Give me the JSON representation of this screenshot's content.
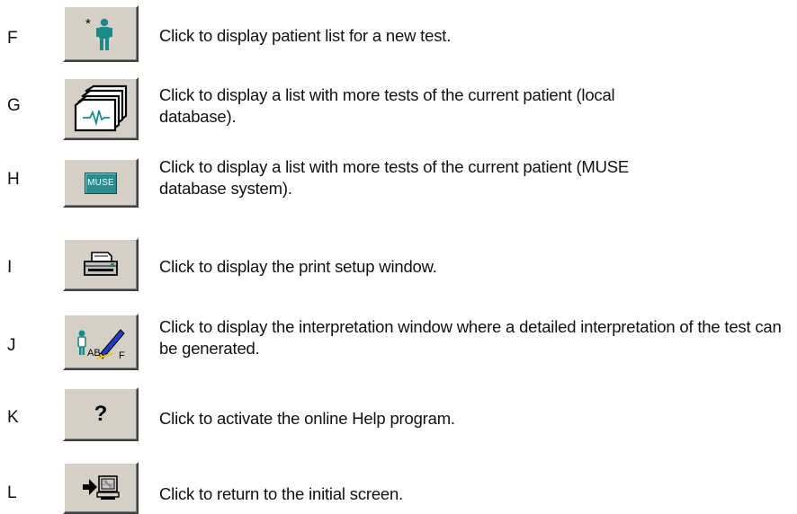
{
  "rows": [
    {
      "letter": "F",
      "text": "Click to display patient list for a new test.",
      "icon": "new-patient-icon"
    },
    {
      "letter": "G",
      "text": "Click to display a list with more tests of the current patient (local database).",
      "icon": "local-database-icon"
    },
    {
      "letter": "H",
      "text": "Click to display a list with more tests of the current patient (MUSE database system).",
      "icon": "muse-icon",
      "icon_label": "MUSE"
    },
    {
      "letter": "I",
      "text": "Click to display the print setup window.",
      "icon": "printer-icon"
    },
    {
      "letter": "J",
      "text": "Click to display the interpretation window where a detailed interpretation of the test can be generated.",
      "icon": "interpretation-icon",
      "icon_label": "AB"
    },
    {
      "letter": "K",
      "text": "Click to activate the online Help program.",
      "icon": "help-icon",
      "icon_label": "?"
    },
    {
      "letter": "L",
      "text": "Click to return to the initial screen.",
      "icon": "return-icon"
    }
  ],
  "colors": {
    "button_face": "#d4d0c8",
    "teal_icon": "#1a8a8a",
    "muse_bg": "#2a8c8c"
  }
}
